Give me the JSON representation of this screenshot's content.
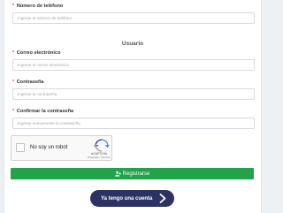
{
  "form": {
    "phone": {
      "label": "Número de teléfono",
      "required_mark": "*",
      "placeholder": "Ingrese el número de teléfono"
    },
    "section_title": "Usuario",
    "email": {
      "label": "Correo electrónico",
      "required_mark": "*",
      "placeholder": "Ingrese el correo electrónico"
    },
    "password": {
      "label": "Contraseña",
      "required_mark": "*",
      "placeholder": "Ingrese la contraseña"
    },
    "confirm_password": {
      "label": "Confirmar la contraseña",
      "required_mark": "*",
      "placeholder": "Ingrese nuevamente la contraseña"
    }
  },
  "recaptcha": {
    "checkbox_label": "No soy un robot",
    "brand": "reCAPTCHA",
    "terms": "Privacidad - Términos"
  },
  "buttons": {
    "register_label": "Registrarse",
    "register_icon": "user-plus-icon",
    "have_account_label": "Ya tengo una cuenta",
    "have_account_icon": "chevron-right-icon"
  },
  "colors": {
    "register_button": "#22a24a",
    "have_account_button": "#2c3361",
    "required_mark": "#d9534f"
  }
}
